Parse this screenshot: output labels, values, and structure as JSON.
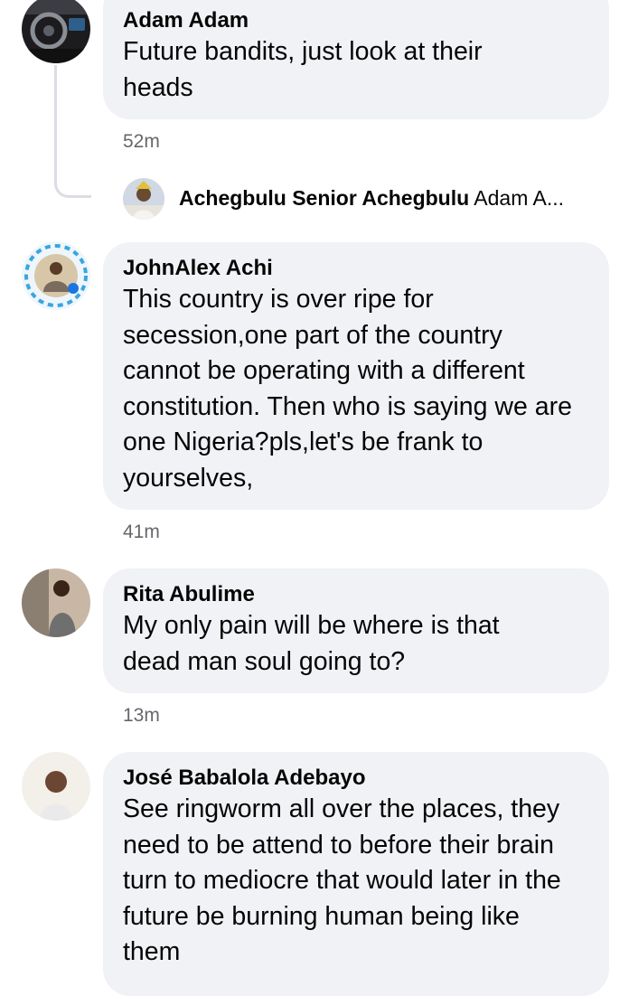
{
  "comments": [
    {
      "author": "Adam Adam",
      "text": "Future bandits, just look at their heads",
      "time": "52m",
      "reply_preview": {
        "author": "Achegbulu Senior Achegbulu",
        "snippet": "Adam A..."
      }
    },
    {
      "author": "JohnAlex Achi",
      "text": "This country is over ripe for secession,one part of the country cannot be operating with a different constitution. Then who is saying we are one Nigeria?pls,let's be frank to yourselves,",
      "time": "41m"
    },
    {
      "author": "Rita Abulime",
      "text": "My only pain will be where is that dead man soul going to?",
      "time": "13m"
    },
    {
      "author": "José Babalola Adebayo",
      "text": "See ringworm all over the places, they need to be attend to before their brain turn to mediocre that would later in the future be burning human being like them"
    }
  ],
  "colors": {
    "bubble": "#f0f2f5",
    "meta_text": "#65676b",
    "thread_line": "#dadde1"
  },
  "icons": [
    "avatar-photo"
  ]
}
